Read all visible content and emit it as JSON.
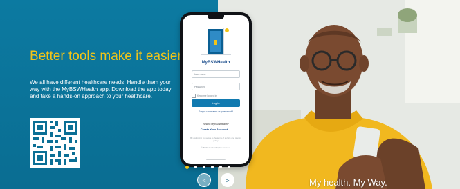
{
  "banner": {
    "headline": "Better tools make it easier",
    "body": "We all have different healthcare needs. Handle them your way with the MyBSWHealth app. Download the app today and take a hands-on approach to your healthcare.",
    "tagline": "My health. My Way.",
    "prev_label": "<",
    "next_label": ">",
    "slide_count": 6,
    "active_slide": 1
  },
  "phone": {
    "brand": "MyBSWHealth",
    "username_placeholder": "Username",
    "password_placeholder": "Password",
    "keep_label": "Keep me logged in",
    "login_label": "Log in",
    "forgot_label": "Forgot username or password?",
    "new_question": "New to MyBSWHealth?",
    "create_label": "Create Your Account →",
    "terms_text": "By continuing you agree to the terms of service and privacy policy",
    "footer_note": "© BSW Health. All rights reserved."
  },
  "colors": {
    "teal": "#0b6f95",
    "accent": "#f2c418",
    "button": "#117ab0",
    "shirt": "#f1b81f"
  },
  "icons": {
    "prev": "chevron-left-icon",
    "next": "chevron-right-icon",
    "qr": "qr-code"
  }
}
